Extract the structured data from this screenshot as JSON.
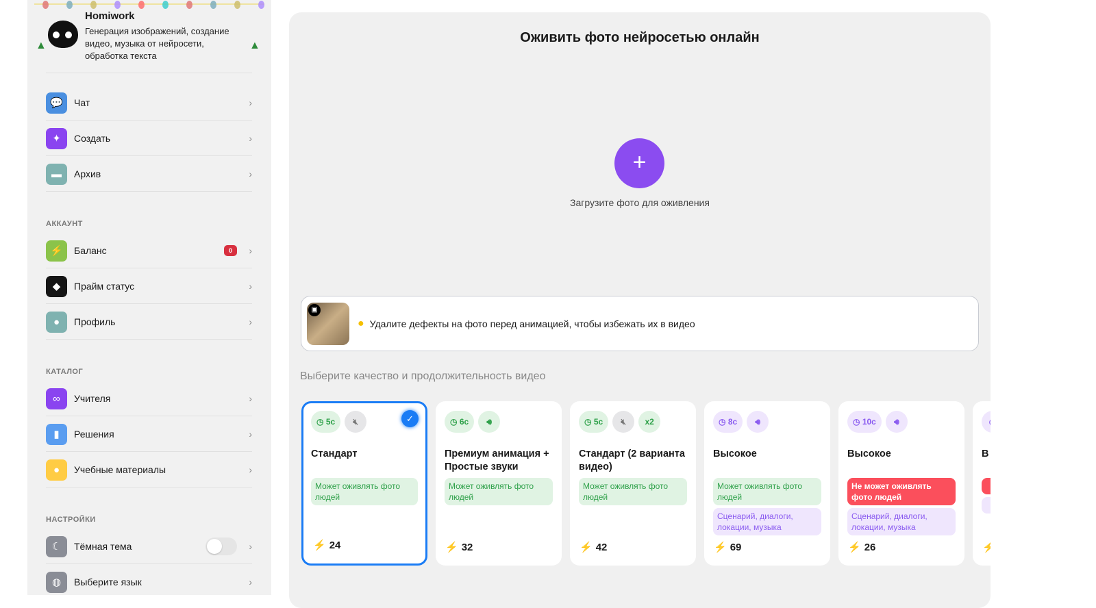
{
  "brand": {
    "name": "Homiwork",
    "description": "Генерация изображений, создание видео, музыка от нейросети, обработка текста"
  },
  "nav": [
    {
      "label": "Чат",
      "icon": "chat-icon",
      "color": "#4a8fe0"
    },
    {
      "label": "Создать",
      "icon": "magic-wand-icon",
      "color": "#8a44f0"
    },
    {
      "label": "Архив",
      "icon": "folder-icon",
      "color": "#7fb2b0"
    }
  ],
  "account": {
    "title": "АККАУНТ",
    "items": [
      {
        "label": "Баланс",
        "icon": "lightning-icon",
        "color": "#8bc34a",
        "badge": "0"
      },
      {
        "label": "Прайм статус",
        "icon": "diamond-icon",
        "color": "#151515"
      },
      {
        "label": "Профиль",
        "icon": "user-icon",
        "color": "#7fb2b0"
      }
    ]
  },
  "catalog": {
    "title": "КАТАЛОГ",
    "items": [
      {
        "label": "Учителя",
        "icon": "glasses-icon",
        "color": "#8a44f0"
      },
      {
        "label": "Решения",
        "icon": "book-icon",
        "color": "#5a9df0"
      },
      {
        "label": "Учебные материалы",
        "icon": "lightbulb-icon",
        "color": "#ffcc44"
      }
    ]
  },
  "settings": {
    "title": "НАСТРОЙКИ",
    "items": [
      {
        "label": "Тёмная тема",
        "icon": "moon-icon",
        "color": "#8a8d96",
        "toggle": false
      },
      {
        "label": "Выберите язык",
        "icon": "globe-icon",
        "color": "#8a8d96"
      }
    ]
  },
  "main": {
    "title": "Оживить фото нейросетью онлайн",
    "upload_label": "Загрузите фото для оживления",
    "tip": "Удалите дефекты на фото перед анимацией, чтобы избежать их в видео",
    "choose_label": "Выберите качество и продолжительность видео"
  },
  "cards": [
    {
      "name": "Стандарт",
      "duration": "5с",
      "sound": false,
      "extra": "",
      "tags": [
        {
          "text": "Может оживлять фото людей",
          "type": "g"
        }
      ],
      "price": "24",
      "selected": true,
      "color": "g"
    },
    {
      "name": "Премиум анимация + Простые звуки",
      "duration": "6с",
      "sound": true,
      "extra": "",
      "tags": [
        {
          "text": "Может оживлять фото людей",
          "type": "g"
        }
      ],
      "price": "32",
      "selected": false,
      "color": "g"
    },
    {
      "name": "Стандарт (2 варианта видео)",
      "duration": "5с",
      "sound": false,
      "extra": "x2",
      "tags": [
        {
          "text": "Может оживлять фото людей",
          "type": "g"
        }
      ],
      "price": "42",
      "selected": false,
      "color": "g"
    },
    {
      "name": "Высокое",
      "duration": "8с",
      "sound": true,
      "extra": "",
      "tags": [
        {
          "text": "Может оживлять фото людей",
          "type": "g"
        },
        {
          "text": "Сценарий, диалоги, локации, музыка",
          "type": "p"
        }
      ],
      "price": "69",
      "selected": false,
      "color": "p"
    },
    {
      "name": "Высокое",
      "duration": "10с",
      "sound": true,
      "extra": "",
      "tags": [
        {
          "text": "Не может оживлять фото людей",
          "type": "r"
        },
        {
          "text": "Сценарий, диалоги, локации, музыка",
          "type": "p"
        }
      ],
      "price": "26",
      "selected": false,
      "color": "p"
    },
    {
      "name": "В",
      "duration": "",
      "sound": true,
      "extra": "",
      "tags": [
        {
          "text": "",
          "type": "r"
        },
        {
          "text": "",
          "type": "p"
        }
      ],
      "price": "",
      "selected": false,
      "color": "p"
    }
  ]
}
